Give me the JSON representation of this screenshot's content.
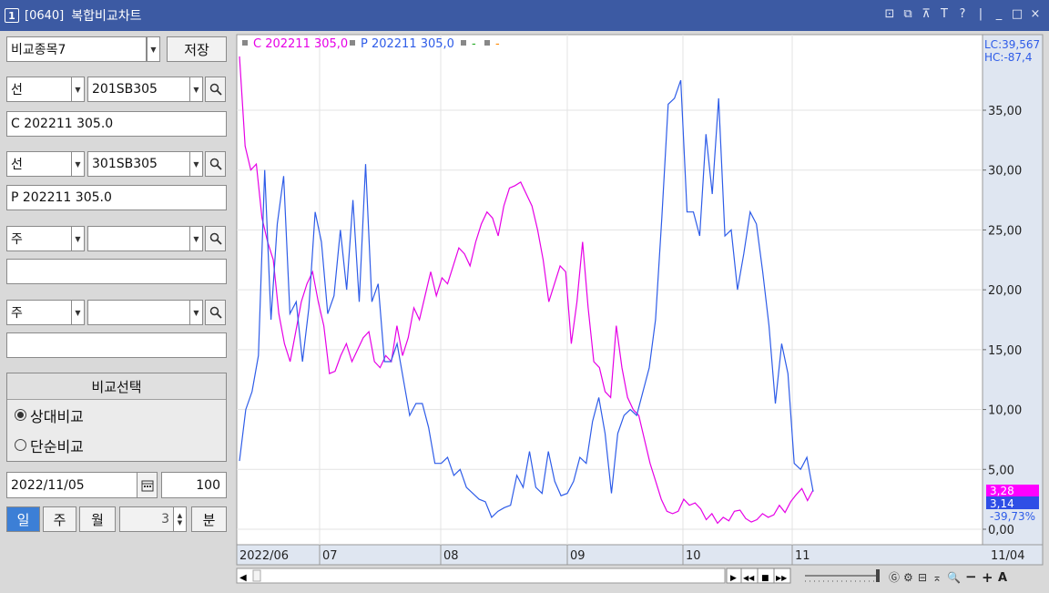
{
  "window": {
    "badge": "1",
    "code": "[0640]",
    "title": "복합비교차트",
    "icons": [
      "restore-icon",
      "detach-icon",
      "pin-icon",
      "text-icon",
      "help-icon",
      "minimize-icon",
      "maximize-icon",
      "close-icon"
    ],
    "icon_glyphs": [
      "⊡",
      "⧉",
      "⊼",
      "T",
      "?",
      "|",
      "_",
      "□",
      "×"
    ]
  },
  "left": {
    "group_select": "비교종목7",
    "save_label": "저장",
    "rows": [
      {
        "type": "선",
        "code": "201SB305",
        "name": "C 202211 305.0"
      },
      {
        "type": "선",
        "code": "301SB305",
        "name": "P 202211 305.0"
      },
      {
        "type": "주",
        "code": "",
        "name": ""
      },
      {
        "type": "주",
        "code": "",
        "name": ""
      }
    ],
    "compare": {
      "header": "비교선택",
      "options": [
        "상대비교",
        "단순비교"
      ],
      "selected": 0
    },
    "date": "2022/11/05",
    "count": "100",
    "periods": [
      "일",
      "주",
      "월"
    ],
    "active_period": 0,
    "minutes_value": "3",
    "minute_label": "분"
  },
  "chart": {
    "legend": [
      {
        "label": "C 202211 305,0",
        "color": "#e600e6"
      },
      {
        "label": "P 202211 305,0",
        "color": "#2e5ce8"
      },
      {
        "label": "-",
        "color": "#22aa22"
      },
      {
        "label": "-",
        "color": "#ff8800"
      }
    ],
    "lc": "LC:39,567",
    "hc": "HC:-87,4",
    "right_tags": [
      {
        "text": "3,28",
        "color": "#ff00ff"
      },
      {
        "text": "3,14",
        "color": "#2e4ee6"
      }
    ],
    "right_extra": "-39,73%",
    "x_axis_last": "11/04",
    "nav_glyphs": [
      "▶",
      "◀◀",
      "■",
      "▶▶"
    ],
    "tool_icons": [
      "crosshair-icon",
      "settings-icon",
      "window-icon",
      "cursor-icon",
      "zoom-icon"
    ],
    "tool_glyphs": [
      "Ⓖ",
      "⚙",
      "⊟",
      "⌅",
      "🔍",
      "−",
      "+",
      "A"
    ]
  },
  "chart_data": {
    "type": "line",
    "yticks": [
      "0,00",
      "5,00",
      "10,00",
      "15,00",
      "20,00",
      "25,00",
      "30,00",
      "35,00"
    ],
    "ylim": [
      0,
      39
    ],
    "xtick_labels": [
      "2022/06",
      "07",
      "08",
      "09",
      "10",
      "11"
    ],
    "series": [
      {
        "name": "C 202211 305,0",
        "color": "#e600e6",
        "values": [
          39.5,
          32.0,
          30.0,
          30.5,
          26.0,
          24.0,
          22.5,
          18.0,
          15.5,
          14.0,
          16.5,
          19.0,
          20.5,
          21.5,
          19.0,
          17.0,
          13.0,
          13.2,
          14.5,
          15.5,
          14.0,
          15.0,
          16.0,
          16.5,
          14.0,
          13.5,
          14.5,
          14.0,
          17.0,
          14.5,
          16.0,
          18.5,
          17.5,
          19.5,
          21.5,
          19.5,
          21.0,
          20.5,
          22.0,
          23.5,
          23.0,
          22.0,
          24.0,
          25.5,
          26.5,
          26.0,
          24.5,
          27.0,
          28.5,
          28.7,
          29.0,
          28.0,
          27.0,
          25.0,
          22.5,
          19.0,
          20.5,
          22.0,
          21.5,
          15.5,
          19.0,
          24.0,
          18.5,
          14.0,
          13.5,
          11.5,
          11.0,
          17.0,
          13.5,
          11.0,
          10.0,
          9.5,
          7.5,
          5.5,
          4.0,
          2.5,
          1.5,
          1.3,
          1.5,
          2.5,
          2.0,
          2.2,
          1.7,
          0.8,
          1.3,
          0.5,
          1.0,
          0.7,
          1.5,
          1.6,
          0.9,
          0.6,
          0.8,
          1.3,
          1.0,
          1.2,
          2.0,
          1.4,
          2.3,
          2.9,
          3.4,
          2.4,
          3.28
        ]
      },
      {
        "name": "P 202211 305,0",
        "color": "#2e5ce8",
        "values": [
          5.7,
          10.0,
          11.5,
          14.5,
          30.0,
          17.5,
          25.5,
          29.5,
          18.0,
          19.0,
          14.0,
          18.5,
          26.5,
          24.0,
          18.0,
          19.5,
          25.0,
          20.0,
          27.5,
          19.0,
          30.5,
          19.0,
          20.5,
          14.0,
          14.0,
          15.5,
          12.5,
          9.5,
          10.5,
          10.5,
          8.5,
          5.5,
          5.5,
          6.0,
          4.5,
          5.0,
          3.5,
          3.0,
          2.5,
          2.3,
          1.0,
          1.5,
          1.8,
          2.0,
          4.5,
          3.5,
          6.5,
          3.5,
          3.0,
          6.5,
          4.0,
          2.8,
          3.0,
          4.0,
          6.0,
          5.5,
          9.0,
          11.0,
          8.0,
          3.0,
          8.0,
          9.5,
          10.0,
          9.5,
          11.5,
          13.5,
          17.5,
          26.0,
          35.5,
          36.0,
          37.5,
          26.5,
          26.5,
          24.5,
          33.0,
          28.0,
          36.0,
          24.5,
          25.0,
          20.0,
          23.0,
          26.5,
          25.5,
          21.5,
          17.0,
          10.5,
          15.5,
          13.0,
          5.5,
          5.0,
          6.0,
          3.14
        ]
      }
    ]
  }
}
